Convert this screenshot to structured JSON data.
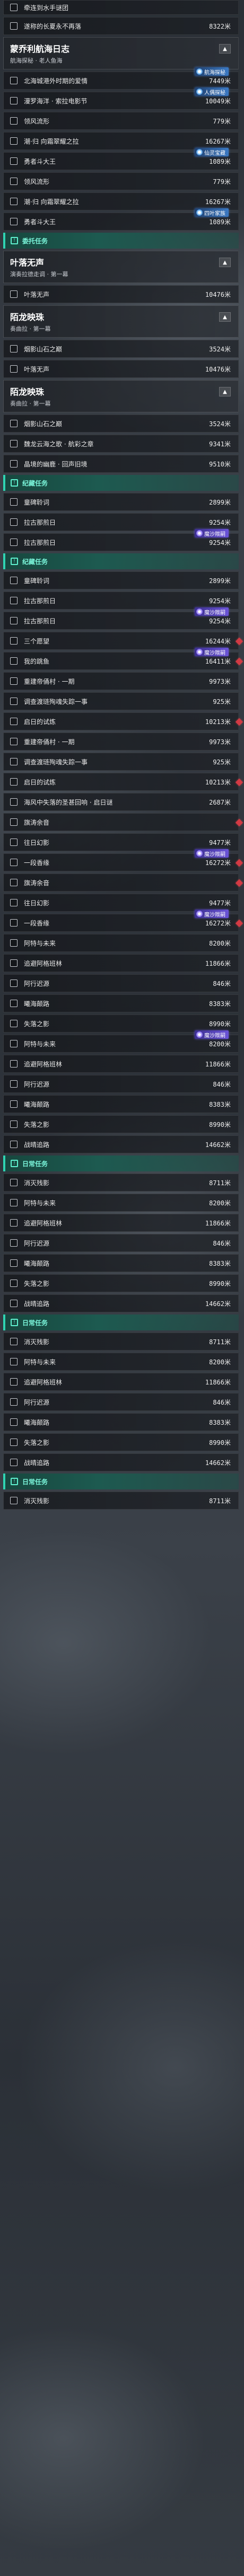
{
  "list": [
    {
      "k": "row",
      "text": "牵连到水手谜团",
      "dist": ""
    },
    {
      "k": "row",
      "text": "遂称的长夏永不再落",
      "dist": "8322米"
    },
    {
      "k": "panel",
      "title": "蒙乔利航海日志",
      "sub": "航海探秘 · 老人鱼海"
    },
    {
      "k": "row",
      "text": "北海城港外时期的爱情",
      "dist": "7449米",
      "tag": "航海探秘",
      "tagc": "blue"
    },
    {
      "k": "row",
      "text": "漫罗海洋 · 索拉电影节",
      "dist": "10049米",
      "tag": "人偶探秘",
      "tagc": "blue"
    },
    {
      "k": "row",
      "text": "领风流形",
      "dist": "779米"
    },
    {
      "k": "row",
      "text": "潮·归 向霜翠耀之拉",
      "dist": "16267米"
    },
    {
      "k": "row",
      "text": "勇者斗大王",
      "dist": "1089米",
      "tag": "仙灵宝藏",
      "tagc": "blue"
    },
    {
      "k": "row",
      "text": "领风流形",
      "dist": "779米"
    },
    {
      "k": "row",
      "text": "潮·归 向霜翠耀之拉",
      "dist": "16267米"
    },
    {
      "k": "row",
      "text": "勇者斗大王",
      "dist": "1089米",
      "tag": "四叶家族",
      "tagc": "blue"
    },
    {
      "k": "section",
      "label": "委托任务"
    },
    {
      "k": "panel",
      "title": "叶落无声",
      "sub": "演奏拉德走调 · 第一幕"
    },
    {
      "k": "row",
      "text": "叶落无声",
      "dist": "10476米"
    },
    {
      "k": "panel",
      "title": "陌龙映珠",
      "sub": "奏曲拉 · 第一幕"
    },
    {
      "k": "row",
      "text": "烟影山石之巅",
      "dist": "3524米"
    },
    {
      "k": "row",
      "text": "叶落无声",
      "dist": "10476米"
    },
    {
      "k": "panel",
      "title": "陌龙映珠",
      "sub": "奏曲拉 · 第一幕"
    },
    {
      "k": "row",
      "text": "烟影山石之巅",
      "dist": "3524米"
    },
    {
      "k": "row",
      "text": "魏龙云海之歌 · 航彩之章",
      "dist": "9341米"
    },
    {
      "k": "row",
      "text": "晶境的幽鹿 · 回声旧境",
      "dist": "9510米"
    },
    {
      "k": "section",
      "label": "纪藏任务"
    },
    {
      "k": "row",
      "text": "童碑聆词",
      "dist": "2899米"
    },
    {
      "k": "row",
      "text": "拉古那煎日",
      "dist": "9254米"
    },
    {
      "k": "row",
      "text": "拉古那煎日",
      "dist": "9254米",
      "tag": "魔沙羰嗣"
    },
    {
      "k": "section",
      "label": "纪藏任务"
    },
    {
      "k": "row",
      "text": "童碑聆词",
      "dist": "2899米"
    },
    {
      "k": "row",
      "text": "拉古那煎日",
      "dist": "9254米"
    },
    {
      "k": "row",
      "text": "拉古那煎日",
      "dist": "9254米",
      "tag": "魔沙羰嗣"
    },
    {
      "k": "row",
      "text": "三个愿望",
      "dist": "16244米",
      "dot": true
    },
    {
      "k": "row",
      "text": "我的跳鱼",
      "dist": "16411米",
      "tag": "魔沙羰嗣",
      "dot": true
    },
    {
      "k": "row",
      "text": "重建帝俑村 · 一期",
      "dist": "9973米"
    },
    {
      "k": "row",
      "text": "调查渡琏殉魂失踪一事",
      "dist": "925米"
    },
    {
      "k": "row",
      "text": "启日的试炼",
      "dist": "10213米",
      "dot": true
    },
    {
      "k": "row",
      "text": "重建帝俑村 · 一期",
      "dist": "9973米"
    },
    {
      "k": "row",
      "text": "调查渡琏殉魂失踪一事",
      "dist": "925米"
    },
    {
      "k": "row",
      "text": "启日的试炼",
      "dist": "10213米",
      "dot": true
    },
    {
      "k": "row",
      "text": "海风中失落的圣甚回响 · 启日谜",
      "dist": "2687米"
    },
    {
      "k": "row",
      "text": "旗涛余音",
      "dist": "",
      "dot": true
    },
    {
      "k": "row",
      "text": "往日幻影",
      "dist": "9477米"
    },
    {
      "k": "row",
      "text": "一段香缘",
      "dist": "16272米",
      "tag": "魔沙羰嗣",
      "dot": true
    },
    {
      "k": "row",
      "text": "旗涛余音",
      "dist": "",
      "dot": true
    },
    {
      "k": "row",
      "text": "往日幻影",
      "dist": "9477米"
    },
    {
      "k": "row",
      "text": "一段香缘",
      "dist": "16272米",
      "tag": "魔沙羰嗣",
      "dot": true
    },
    {
      "k": "row",
      "text": "阿特与未来",
      "dist": "8200米"
    },
    {
      "k": "row",
      "text": "追避阿格班林",
      "dist": "11866米"
    },
    {
      "k": "row",
      "text": "阿行迟源",
      "dist": "846米"
    },
    {
      "k": "row",
      "text": "曦海颠路",
      "dist": "8383米"
    },
    {
      "k": "row",
      "text": "失落之影",
      "dist": "8990米"
    },
    {
      "k": "row",
      "text": "阿特与未来",
      "dist": "8200米",
      "tag": "魔沙羰嗣"
    },
    {
      "k": "row",
      "text": "追避阿格班林",
      "dist": "11866米"
    },
    {
      "k": "row",
      "text": "阿行迟源",
      "dist": "846米"
    },
    {
      "k": "row",
      "text": "曦海颠路",
      "dist": "8383米"
    },
    {
      "k": "row",
      "text": "失落之影",
      "dist": "8990米"
    },
    {
      "k": "row",
      "text": "战晴追路",
      "dist": "14662米"
    },
    {
      "k": "section",
      "label": "日常任务"
    },
    {
      "k": "row",
      "text": "消灭残影",
      "dist": "8711米"
    },
    {
      "k": "row",
      "text": "阿特与未来",
      "dist": "8200米"
    },
    {
      "k": "row",
      "text": "追避阿格班林",
      "dist": "11866米"
    },
    {
      "k": "row",
      "text": "阿行迟源",
      "dist": "846米"
    },
    {
      "k": "row",
      "text": "曦海颠路",
      "dist": "8383米"
    },
    {
      "k": "row",
      "text": "失落之影",
      "dist": "8990米"
    },
    {
      "k": "row",
      "text": "战晴追路",
      "dist": "14662米"
    },
    {
      "k": "section",
      "label": "日常任务"
    },
    {
      "k": "row",
      "text": "消灭残影",
      "dist": "8711米"
    },
    {
      "k": "row",
      "text": "阿特与未来",
      "dist": "8200米"
    },
    {
      "k": "row",
      "text": "追避阿格班林",
      "dist": "11866米"
    },
    {
      "k": "row",
      "text": "阿行迟源",
      "dist": "846米"
    },
    {
      "k": "row",
      "text": "曦海颠路",
      "dist": "8383米"
    },
    {
      "k": "row",
      "text": "失落之影",
      "dist": "8990米"
    },
    {
      "k": "row",
      "text": "战晴追路",
      "dist": "14662米"
    },
    {
      "k": "section",
      "label": "日常任务"
    },
    {
      "k": "row",
      "text": "消灭残影",
      "dist": "8711米"
    }
  ],
  "icons": {
    "checkbox": "checkbox-icon",
    "caret": "collapse-caret-icon",
    "section": "task-category-icon",
    "tag": "region-tag-icon",
    "alert": "alert-diamond-icon"
  },
  "colors": {
    "accent_teal": "#2fd3b2",
    "tag_purple": "#6a53d8",
    "tag_blue": "#3a78c2",
    "alert_red": "#d23a44"
  },
  "glyphs": {
    "caret": "▲",
    "section_icon": "!"
  }
}
